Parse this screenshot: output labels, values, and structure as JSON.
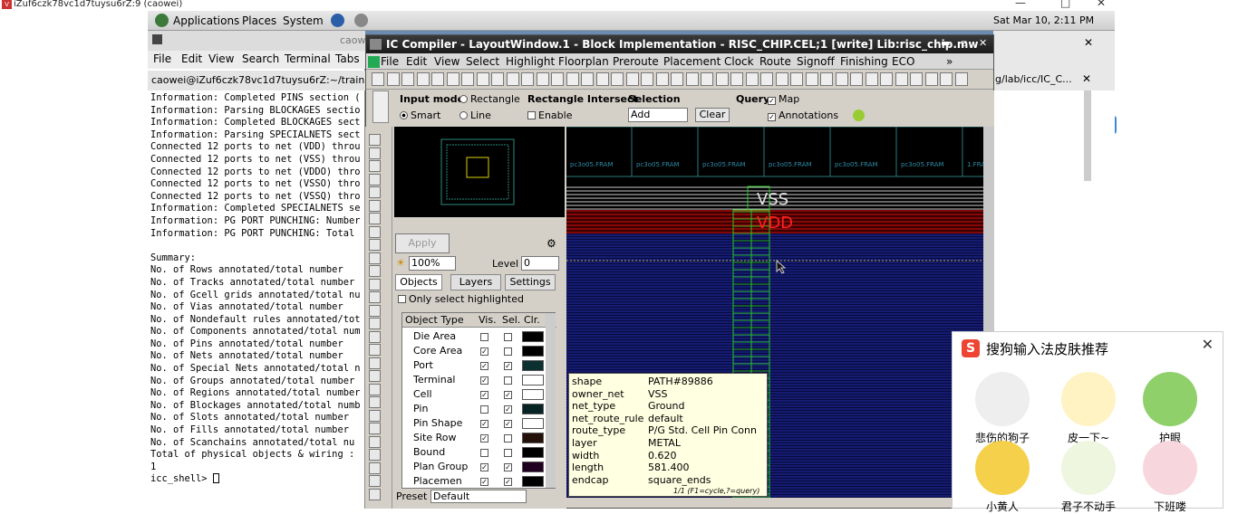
{
  "vnc": {
    "title": "iZuf6czk78vc1d7tuysu6rZ:9 (caowei)"
  },
  "panel_top": {
    "applications": "Applications",
    "places": "Places",
    "system": "System",
    "clock": "Sat Mar 10,  2:11 PM"
  },
  "terminal": {
    "title": "caowei",
    "menu": [
      "File",
      "Edit",
      "View",
      "Search",
      "Terminal",
      "Tabs"
    ],
    "path": "caowei@iZuf6czk78vc1d7tuysu6rZ:~/trainin",
    "lines": [
      "Information: Completed PINS section (",
      "Information: Parsing BLOCKAGES sectio",
      "Information: Completed BLOCKAGES sect",
      "Information: Parsing SPECIALNETS sect",
      "Connected 12 ports to net (VDD) throu",
      "Connected 12 ports to net (VSS) throu",
      "Connected 12 ports to net (VDDO) thro",
      "Connected 12 ports to net (VSSO) thro",
      "Connected 12 ports to net (VSSQ) thro",
      "Information: Completed SPECIALNETS se",
      "Information: PG PORT PUNCHING: Number",
      "Information: PG PORT PUNCHING: Total",
      "",
      "Summary:",
      "No. of Rows annotated/total number",
      "No. of Tracks annotated/total number",
      "No. of Gcell grids annotated/total nu",
      "No. of Vias annotated/total number",
      "No. of Nondefault rules annotated/tot",
      "No. of Components annotated/total num",
      "No. of Pins annotated/total number",
      "No. of Nets annotated/total number",
      "No. of Special Nets annotated/total n",
      "No. of Groups annotated/total number",
      "No. of Regions annotated/total number",
      "No. of Blockages annotated/total numb",
      "No. of Slots annotated/total number",
      "No. of Fills annotated/total number",
      "No. of Scanchains annotated/total nu",
      "Total of physical objects & wiring :",
      "1",
      "icc_shell> "
    ]
  },
  "right_terminal": {
    "path": "g/lab/icc/IC_C..."
  },
  "icc": {
    "title": "IC Compiler - LayoutWindow.1 - Block Implementation - RISC_CHIP.CEL;1 [write]    Lib:risc_chip.mw",
    "menu": [
      "File",
      "Edit",
      "View",
      "Select",
      "Highlight",
      "Floorplan",
      "Preroute",
      "Placement",
      "Clock",
      "Route",
      "Signoff",
      "Finishing",
      "ECO"
    ],
    "input_mode_label": "Input mode",
    "rectangle": "Rectangle",
    "smart": "Smart",
    "line": "Line",
    "rect_intersect": "Rectangle Intersect",
    "enable": "Enable",
    "selection_label": "Selection",
    "selection_value": "Add",
    "clear": "Clear",
    "query_label": "Query",
    "map": "Map",
    "annotations": "Annotations",
    "apply": "Apply",
    "zoom": "100%",
    "level_label": "Level",
    "level_value": "0",
    "tabs": [
      "Objects",
      "Layers",
      "Settings"
    ],
    "only_select_highlighted": "Only select highlighted",
    "table_headers": [
      "Object Type",
      "Vis.",
      "Sel.",
      "Clr."
    ],
    "table_rows": [
      {
        "name": "Die Area",
        "vis": false,
        "sel": false
      },
      {
        "name": "Core Area",
        "vis": true,
        "sel": false
      },
      {
        "name": "Port",
        "vis": true,
        "sel": true
      },
      {
        "name": "Terminal",
        "vis": true,
        "sel": false
      },
      {
        "name": "Cell",
        "vis": true,
        "sel": true
      },
      {
        "name": "Pin",
        "vis": false,
        "sel": true
      },
      {
        "name": "Pin Shape",
        "vis": true,
        "sel": true
      },
      {
        "name": "Site Row",
        "vis": true,
        "sel": false
      },
      {
        "name": "Bound",
        "vis": false,
        "sel": false
      },
      {
        "name": "Plan Group",
        "vis": true,
        "sel": true
      },
      {
        "name": "Placemen",
        "vis": true,
        "sel": true
      }
    ],
    "preset_label": "Preset",
    "preset_value": "Default",
    "canvas_vss": "VSS",
    "canvas_vdd": "VDD",
    "pad_labels": [
      "pc3o05.FRAM",
      "pc3o05.FRAM",
      "pc3o05.FRAM",
      "pc3o05.FRAM",
      "pc3o05.FRAM",
      "pc3o05.FRAM",
      "1.FRA"
    ],
    "properties": [
      {
        "k": "shape",
        "v": "PATH#89886"
      },
      {
        "k": "owner_net",
        "v": "VSS"
      },
      {
        "k": "net_type",
        "v": "Ground"
      },
      {
        "k": "net_route_rule",
        "v": "default"
      },
      {
        "k": "route_type",
        "v": "P/G Std. Cell Pin Conn"
      },
      {
        "k": "layer",
        "v": "METAL"
      },
      {
        "k": "width",
        "v": "0.620"
      },
      {
        "k": "length",
        "v": "581.400"
      },
      {
        "k": "endcap",
        "v": "square_ends"
      }
    ],
    "prop_footer": "1/1 (F1=cycle,?=query)"
  },
  "sogou": {
    "title": "搜狗输入法皮肤推荐",
    "skins": [
      "悲伤的狗子",
      "皮一下~",
      "护眼",
      "小黄人",
      "君子不动手",
      "下班喽"
    ]
  },
  "colors": {
    "vss": "#e0e0e0",
    "vdd": "#ff2020",
    "canvas_bg": "#000000",
    "routing_blue": "#1a2a9a",
    "highlight_green": "#22cc22"
  }
}
